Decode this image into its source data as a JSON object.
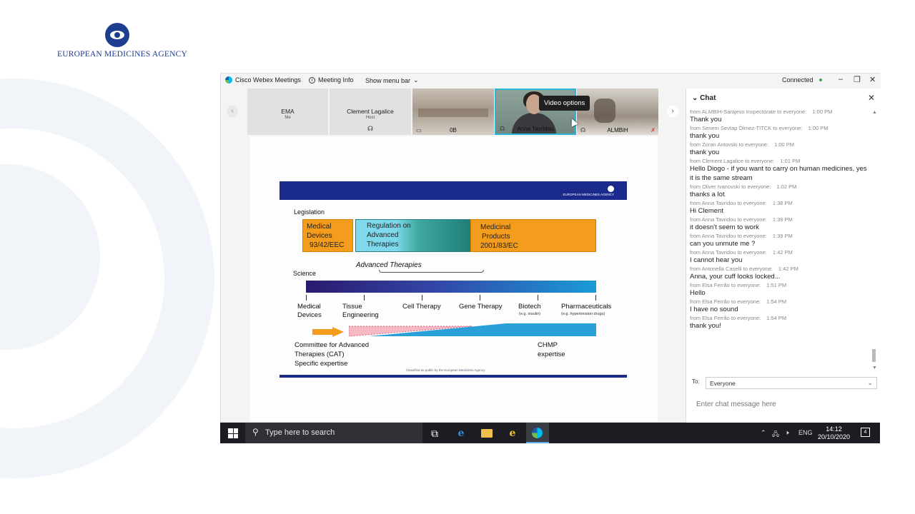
{
  "colors": {
    "ema_blue": "#1d3d8f",
    "slide_blue": "#1b2b8c",
    "orange": "#f49c1b",
    "tile_highlight": "#2bb5d8",
    "taskbar": "#1b1d22"
  },
  "brand": {
    "agency_name": "EUROPEAN MEDICINES AGENCY",
    "icon": "ema-emblem"
  },
  "webex": {
    "app_name": "Cisco Webex Meetings",
    "meeting_info": "Meeting Info",
    "show_menu_bar": "Show menu bar",
    "status": "Connected",
    "window_controls": [
      "minimize-icon",
      "restore-icon",
      "close-icon"
    ]
  },
  "participants": [
    {
      "name": "EMA",
      "sub": "Me",
      "type": "avatar"
    },
    {
      "name": "Clement Lagalice",
      "sub": "Host",
      "type": "avatar"
    },
    {
      "name": "0B",
      "type": "video"
    },
    {
      "name": "Anna Tavridou",
      "type": "video",
      "active": true
    },
    {
      "name": "ALMBiH",
      "type": "video"
    }
  ],
  "tooltip": "Video options",
  "slide": {
    "header_logo": "EUROPEAN MEDICINES AGENCY",
    "legislation_label": "Legislation",
    "medical_devices": [
      "Medical",
      "Devices",
      "93/42/EEC"
    ],
    "regulation": [
      "Regulation on",
      "Advanced",
      "Therapies"
    ],
    "medicinal_products": [
      "Medicinal",
      "Products",
      "2001/83/EC"
    ],
    "advanced_therapies": "Advanced Therapies",
    "science_label": "Science",
    "science_items": [
      {
        "label": "Medical\nDevices"
      },
      {
        "label": "Tissue\nEngineering"
      },
      {
        "label": "Cell Therapy"
      },
      {
        "label": "Gene Therapy"
      },
      {
        "label": "Biotech",
        "note": "(e.g. insulin)"
      },
      {
        "label": "Pharmaceuticals",
        "note": "(e.g. hypertension drugs)"
      }
    ],
    "cat": [
      "Committee for Advanced",
      "Therapies (CAT)",
      "Specific expertise"
    ],
    "chmp": [
      "CHMP",
      "expertise"
    ],
    "footer_note": "Classified as public by the European Medicines Agency"
  },
  "chat": {
    "title": "Chat",
    "messages": [
      {
        "from": "from ALMBIH-Sarajevo Inspectorate to everyone:",
        "time": "1:00 PM",
        "text": "Thank you"
      },
      {
        "from": "from Senem Sevtap Ölmez-TITCK to everyone:",
        "time": "1:00 PM",
        "text": "thank you"
      },
      {
        "from": "from Zoran Antovski to everyone:",
        "time": "1:00 PM",
        "text": "thank you"
      },
      {
        "from": "from Clement Lagalice to everyone:",
        "time": "1:01 PM",
        "text": "Hello Diogo - if you want to carry on human medicines, yes it is the same stream"
      },
      {
        "from": "from Oliver Ivanovski to everyone:",
        "time": "1:02 PM",
        "text": "thanks a lot"
      },
      {
        "from": "from Anna Tavridou to everyone:",
        "time": "1:38 PM",
        "text": "Hi Clement"
      },
      {
        "from": "from Anna Tavridou to everyone:",
        "time": "1:39 PM",
        "text": "it doesn't seem to work"
      },
      {
        "from": "from Anna Tavridou to everyone:",
        "time": "1:39 PM",
        "text": "can you unmute me ?"
      },
      {
        "from": "from Anna Tavridou to everyone:",
        "time": "1:42 PM",
        "text": "I cannot hear you"
      },
      {
        "from": "from Antonella Caselli to everyone:",
        "time": "1:42 PM",
        "text": "Anna, your cuff looks locked..."
      },
      {
        "from": "from Elsa Ferrão to everyone:",
        "time": "1:51 PM",
        "text": "Hello"
      },
      {
        "from": "from Elsa Ferrão to everyone:",
        "time": "1:54 PM",
        "text": "I have no sound"
      },
      {
        "from": "from Elsa Ferrão to everyone:",
        "time": "1:54 PM",
        "text": "thank you!"
      }
    ],
    "to_label": "To:",
    "to_value": "Everyone",
    "input_placeholder": "Enter chat message here"
  },
  "taskbar": {
    "search_placeholder": "Type here to search",
    "language": "ENG",
    "time": "14:12",
    "date": "20/10/2020",
    "notifications": "4"
  }
}
